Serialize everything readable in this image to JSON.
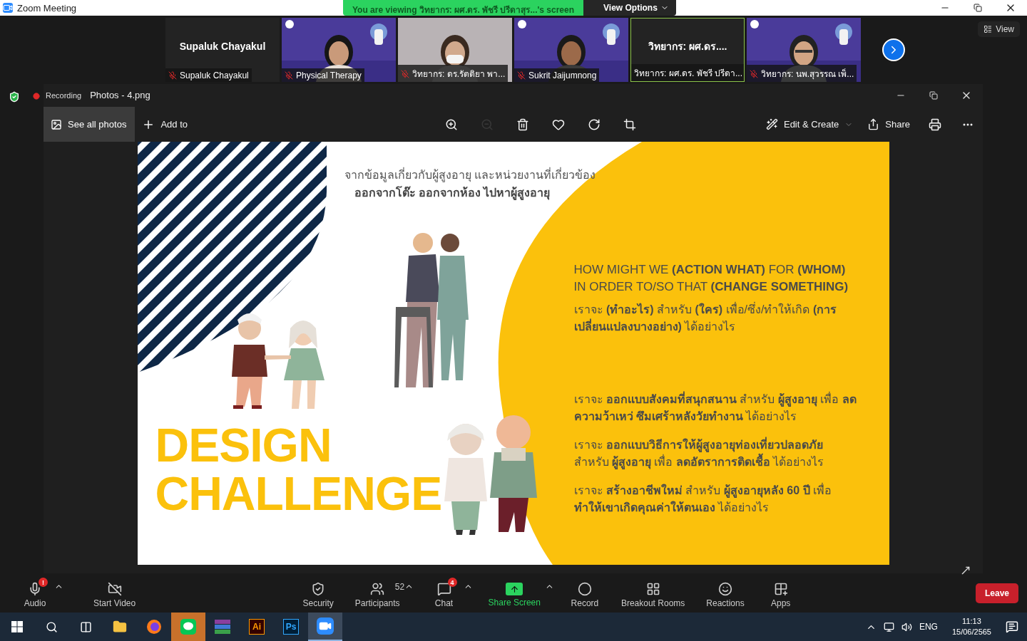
{
  "window": {
    "title": "Zoom Meeting"
  },
  "share_banner": {
    "text": "You are viewing วิทยากร: ผศ.ดร. พัชรี ปรีดาสุร...'s screen",
    "options": "View Options"
  },
  "participants": [
    {
      "kind": "name",
      "display": "Supaluk Chayakul",
      "label": "Supaluk Chayakul",
      "muted": true,
      "selected": false
    },
    {
      "kind": "video",
      "label": "Physical Therapy",
      "muted": true,
      "selected": false
    },
    {
      "kind": "video",
      "label": "วิทยากร: ดร.รัตติยา พา...",
      "muted": true,
      "selected": false
    },
    {
      "kind": "video",
      "label": "Sukrit Jaijumnong",
      "muted": true,
      "selected": false
    },
    {
      "kind": "name",
      "display": "วิทยากร: ผศ.ดร....",
      "label": "วิทยากร: ผศ.ดร. พัชรี ปรีดา...",
      "muted": false,
      "selected": true
    },
    {
      "kind": "video",
      "label": "วิทยากร: นพ.สุวรรณ เพ็...",
      "muted": true,
      "selected": false
    }
  ],
  "view_button": "View",
  "recording": "Recording",
  "photos": {
    "title": "Photos - 4.png",
    "see_all": "See all photos",
    "add_to": "Add to",
    "tools": [
      {
        "kind": "zoom-in",
        "disabled": false
      },
      {
        "kind": "zoom-out",
        "disabled": true
      },
      {
        "kind": "delete",
        "disabled": false
      },
      {
        "kind": "favorite",
        "disabled": false
      },
      {
        "kind": "rotate",
        "disabled": false
      },
      {
        "kind": "crop",
        "disabled": false
      }
    ],
    "edit": "Edit & Create",
    "share": "Share"
  },
  "slide": {
    "intro": "จากข้อมูลเกี่ยวกับผู้สูงอายุ และหน่วยงานที่เกี่ยวข้อง",
    "intro_bold": "ออกจากโต๊ะ ออกจากห้อง ไปหาผู้สูงอายุ",
    "title_lines": [
      "DESIGN",
      "CHALLENGE"
    ],
    "paragraphs": [
      {
        "kind": "caps",
        "text": "HOW MIGHT WE **(ACTION WHAT)** FOR **(WHOM)** IN ORDER TO/SO THAT **(CHANGE SOMETHING)**"
      },
      {
        "kind": "template",
        "text": "เราจะ **(ทำอะไร)** สำหรับ **(ใคร)** เพื่อ/ซึ่ง/ทำให้เกิด **(การเปลี่ยนแปลงบางอย่าง)** ได้อย่างไร"
      },
      {
        "kind": "example",
        "text": "เราจะ **ออกแบบสังคมที่สนุกสนาน** สำหรับ **ผู้สูงอายุ** เพื่อ **ลดความว้าเหว่ ซึมเศร้าหลังวัยทำงาน** ได้อย่างไร"
      },
      {
        "kind": "example",
        "text": "เราจะ **ออกแบบวิธีการให้ผู้สูงอายุท่องเที่ยวปลอดภัย** สำหรับ **ผู้สูงอายุ** เพื่อ **ลดอัตราการติดเชื้อ** ได้อย่างไร"
      },
      {
        "kind": "example",
        "text": "เราจะ **สร้างอาชีพใหม่** สำหรับ **ผู้สูงอายุหลัง 60 ปี** เพื่อ **ทำให้เขาเกิดคุณค่าให้ตนเอง** ได้อย่างไร"
      }
    ]
  },
  "controls": [
    {
      "kind": "audio",
      "label": "Audio",
      "badge": "!",
      "caret": true
    },
    {
      "kind": "video",
      "label": "Start Video",
      "caret": false
    },
    {
      "kind": "security",
      "label": "Security",
      "caret": false
    },
    {
      "kind": "participants",
      "label": "Participants",
      "count": "52",
      "caret": true
    },
    {
      "kind": "chat",
      "label": "Chat",
      "badge": "4",
      "caret": true
    },
    {
      "kind": "share",
      "label": "Share Screen",
      "caret": true
    },
    {
      "kind": "record",
      "label": "Record",
      "caret": false
    },
    {
      "kind": "breakout",
      "label": "Breakout Rooms",
      "caret": false
    },
    {
      "kind": "reactions",
      "label": "Reactions",
      "caret": false
    },
    {
      "kind": "apps",
      "label": "Apps",
      "caret": false
    }
  ],
  "leave": "Leave",
  "taskbar": {
    "apps": [
      {
        "kind": "start",
        "selected": false,
        "attention": false
      },
      {
        "kind": "search",
        "selected": false,
        "attention": false
      },
      {
        "kind": "taskview",
        "selected": false,
        "attention": false
      },
      {
        "kind": "explorer",
        "selected": false,
        "attention": false
      },
      {
        "kind": "firefox",
        "selected": false,
        "attention": false
      },
      {
        "kind": "line",
        "selected": false,
        "attention": true
      },
      {
        "kind": "archive",
        "selected": false,
        "attention": false
      },
      {
        "kind": "illustrator",
        "label": "Ai",
        "selected": false,
        "attention": false
      },
      {
        "kind": "photoshop",
        "label": "Ps",
        "selected": false,
        "attention": false
      },
      {
        "kind": "zoom",
        "selected": true,
        "attention": false
      }
    ],
    "language": "ENG",
    "time": "11:13",
    "date": "15/06/2565"
  }
}
